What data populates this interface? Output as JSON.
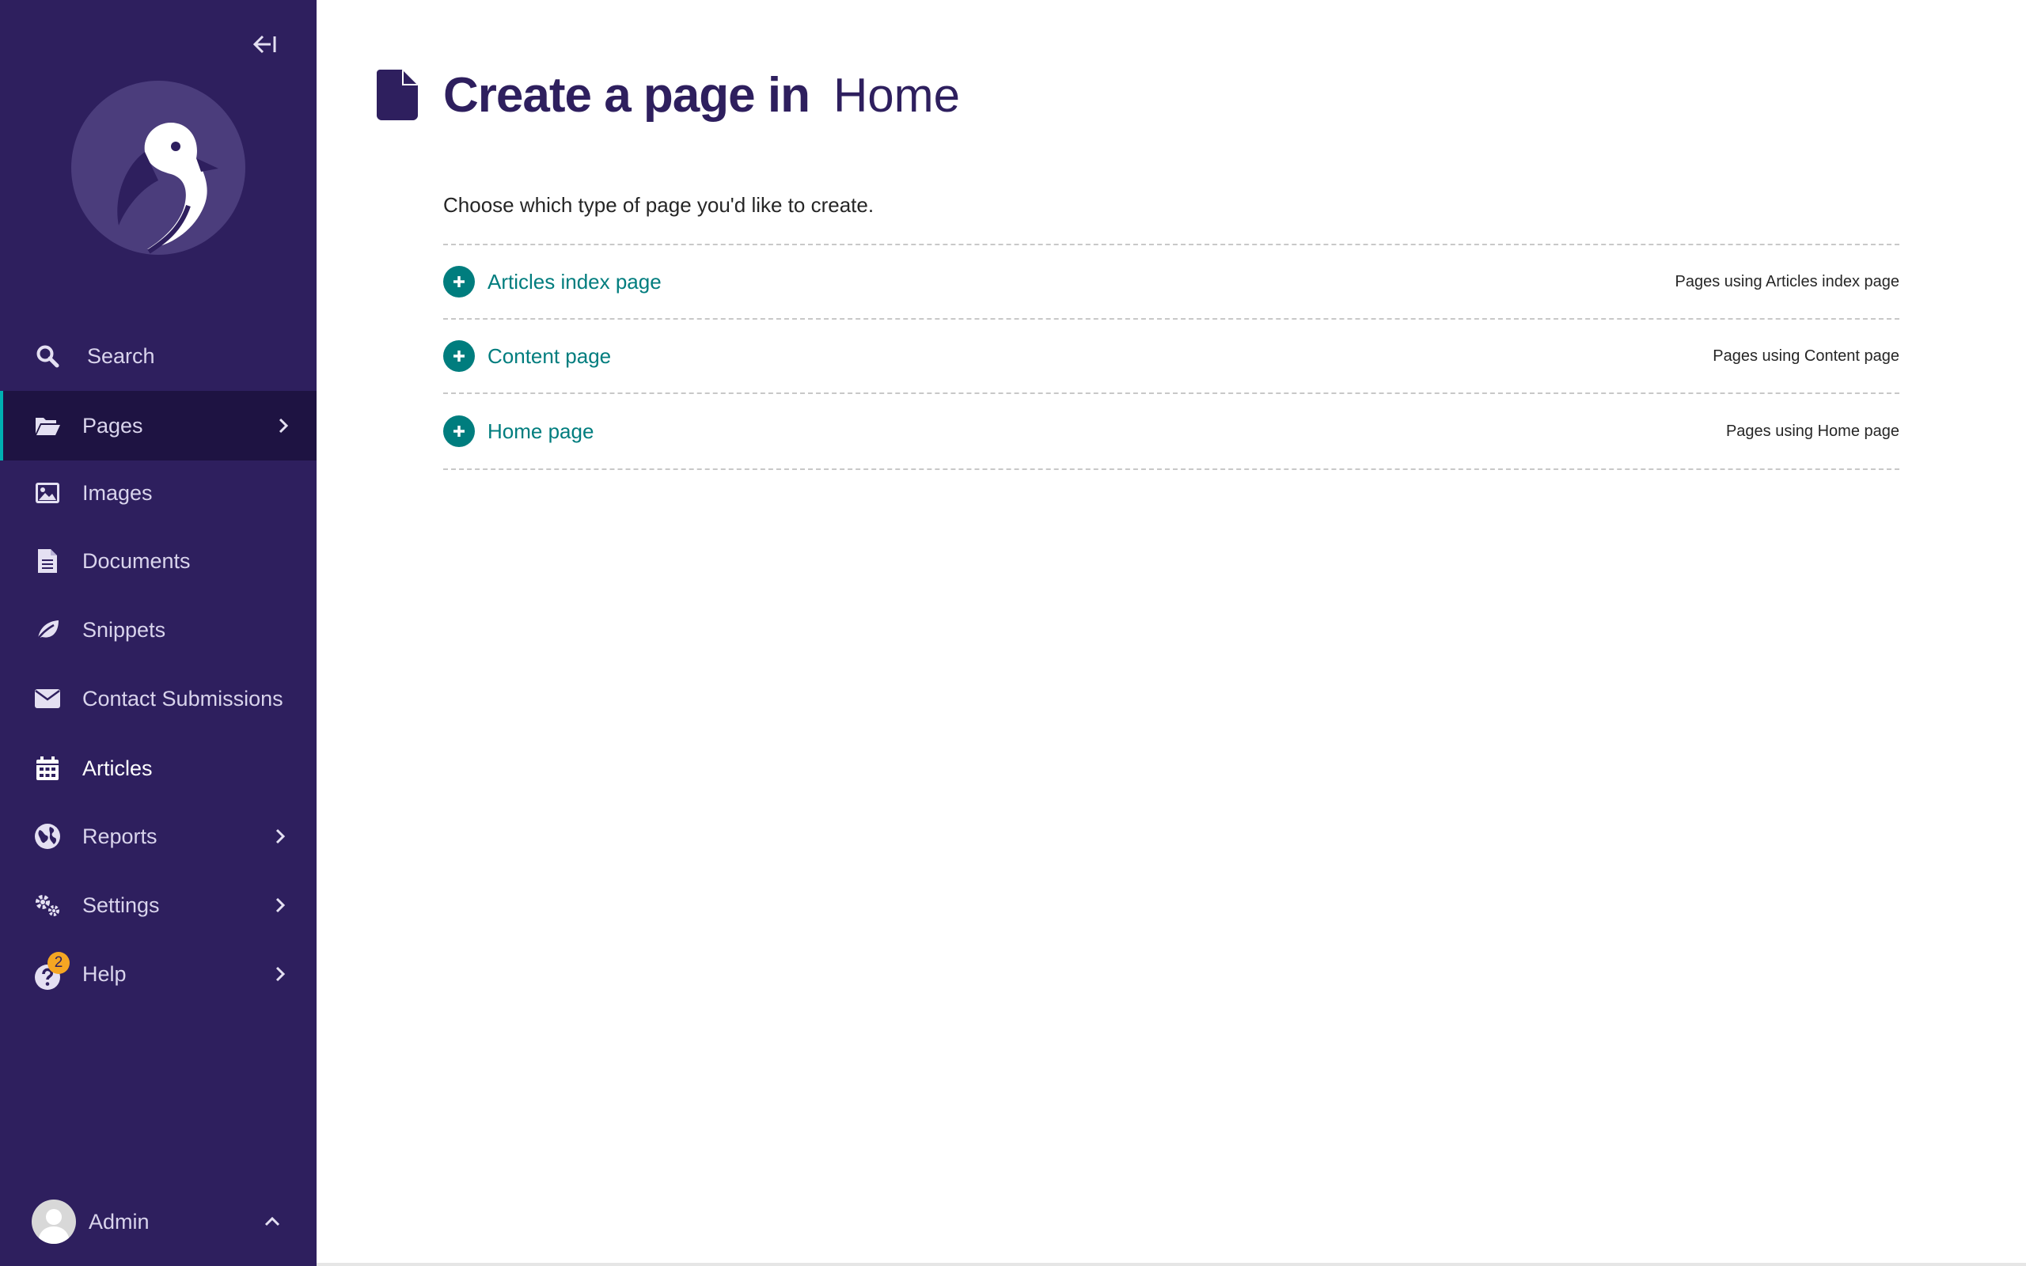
{
  "sidebar": {
    "search_label": "Search",
    "items": [
      {
        "label": "Pages",
        "icon": "folder-open-icon",
        "active": true,
        "has_submenu": true
      },
      {
        "label": "Images",
        "icon": "image-icon",
        "has_submenu": false
      },
      {
        "label": "Documents",
        "icon": "document-icon",
        "has_submenu": false
      },
      {
        "label": "Snippets",
        "icon": "leaf-icon",
        "has_submenu": false
      },
      {
        "label": "Contact Submissions",
        "icon": "envelope-icon",
        "has_submenu": false
      },
      {
        "label": "Articles",
        "icon": "calendar-icon",
        "has_submenu": false
      },
      {
        "label": "Reports",
        "icon": "globe-icon",
        "has_submenu": true
      },
      {
        "label": "Settings",
        "icon": "cogs-icon",
        "has_submenu": true
      },
      {
        "label": "Help",
        "icon": "help-icon",
        "has_submenu": true,
        "badge": "2"
      }
    ],
    "account_label": "Admin"
  },
  "header": {
    "title": "Create a page in",
    "subtitle": "Home"
  },
  "intro_text": "Choose which type of page you'd like to create.",
  "page_types": [
    {
      "label": "Articles index page",
      "usage": "Pages using Articles index page"
    },
    {
      "label": "Content page",
      "usage": "Pages using Content page"
    },
    {
      "label": "Home page",
      "usage": "Pages using Home page"
    }
  ],
  "colors": {
    "sidebar_bg": "#2e1f5e",
    "active_bg": "#1e1342",
    "accent_teal": "#007d7e",
    "badge": "#f5a623",
    "title": "#2e1f5e"
  }
}
